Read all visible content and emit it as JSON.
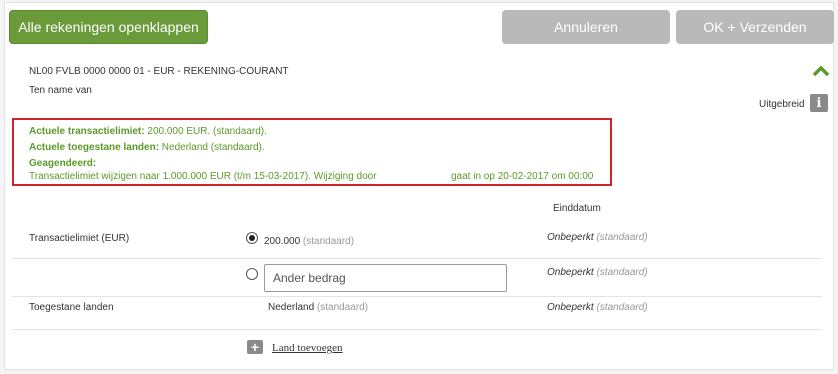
{
  "toolbar": {
    "expand_all": "Alle rekeningen openklappen",
    "cancel": "Annuleren",
    "ok_send": "OK + Verzenden"
  },
  "account": {
    "number": "NL00 FVLB 0000 0000 01 - EUR - REKENING-COURANT",
    "holder": "Ten name van",
    "advanced_label": "Uitgebreid",
    "info_glyph": "i"
  },
  "summary": {
    "limit_label": "Actuele transactielimiet:",
    "limit_value": " 200.000 EUR. (standaard).",
    "countries_label": "Actuele toegestane landen:",
    "countries_value": " Nederland (standaard).",
    "agreed_label": "Geagendeerd:",
    "agreed_text": "Transactielimiet wijzigen naar 1.000.000 EUR (t/m 15-03-2017). Wijziging door",
    "agreed_date": "gaat in op 20-02-2017 om 00:00"
  },
  "table": {
    "end_date_header": "Einddatum",
    "limit_row_label": "Transactielimiet (EUR)",
    "option1_value": "200.000",
    "option1_tag": " (standaard)",
    "option1_end": "Onbeperkt",
    "option1_end_tag": " (standaard)",
    "option2_placeholder": "Ander bedrag",
    "option2_end": "Onbeperkt",
    "option2_end_tag": " (standaard)",
    "countries_row_label": "Toegestane landen",
    "country_value": "Nederland",
    "country_tag": " (standaard)",
    "country_end": "Onbeperkt",
    "country_end_tag": " (standaard)",
    "add_country": "Land toevoegen"
  }
}
